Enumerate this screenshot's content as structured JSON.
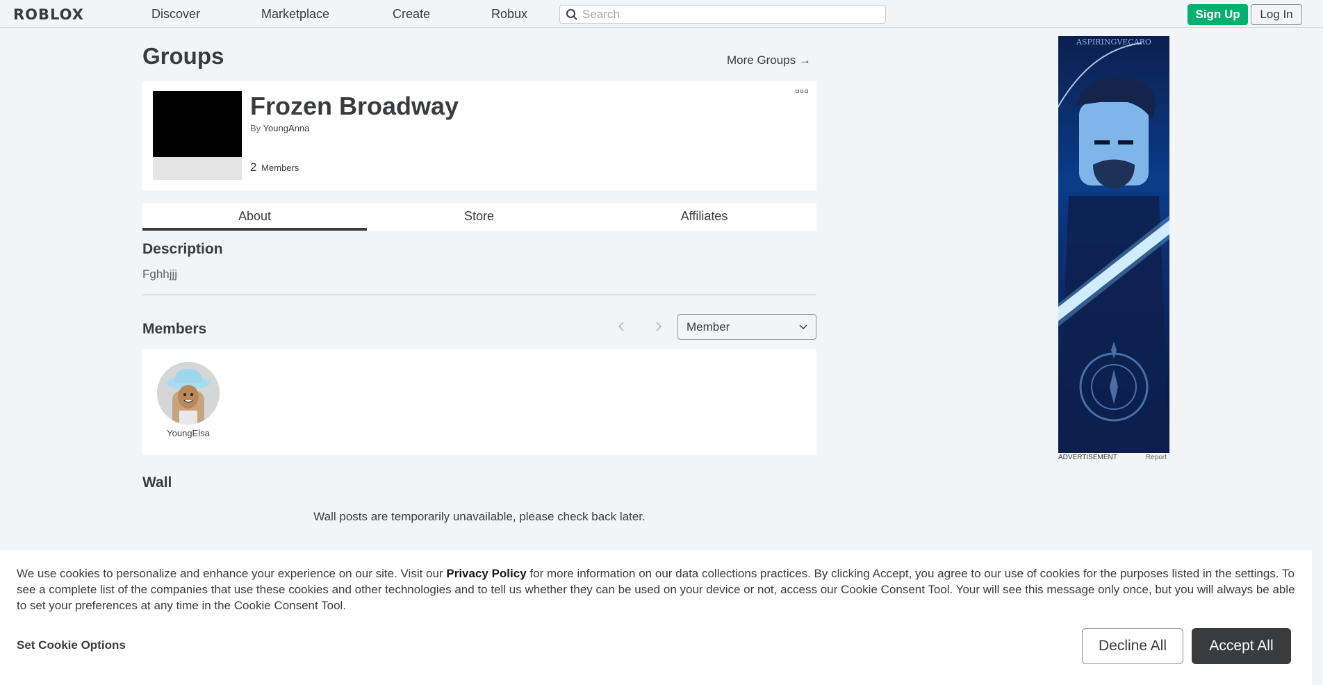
{
  "nav": {
    "logo": "ROBLOX",
    "links": [
      "Discover",
      "Marketplace",
      "Create",
      "Robux"
    ],
    "search_placeholder": "Search",
    "signup": "Sign Up",
    "login": "Log In"
  },
  "page": {
    "heading": "Groups",
    "more_groups": "More Groups →"
  },
  "group": {
    "name": "Frozen Broadway",
    "by_label": "By",
    "owner": "YoungAnna",
    "member_count": "2",
    "members_label": "Members"
  },
  "tabs": [
    "About",
    "Store",
    "Affiliates"
  ],
  "description": {
    "heading": "Description",
    "text": "Fghhjjj"
  },
  "members": {
    "heading": "Members",
    "role_selected": "Member",
    "list": [
      {
        "name": "YoungElsa"
      }
    ]
  },
  "wall": {
    "heading": "Wall",
    "message": "Wall posts are temporarily unavailable, please check back later."
  },
  "ad": {
    "label": "ADVERTISEMENT",
    "report": "Report",
    "brand_text": "ASPIRINGVECARO"
  },
  "cookie": {
    "text_before": "We use cookies to personalize and enhance your experience on our site. Visit our ",
    "privacy_link": "Privacy Policy",
    "text_after": " for more information on our data collections practices. By clicking Accept, you agree to our use of cookies for the purposes listed in the settings. To see a complete list of the companies that use these cookies and other technologies and to tell us whether they can be used on your device or not, access our Cookie Consent Tool. Your will see this message only once, but you will always be able to set your preferences at any time in the Cookie Consent Tool.",
    "set_options": "Set Cookie Options",
    "decline": "Decline All",
    "accept": "Accept All"
  },
  "colors": {
    "signup_green": "#00b06f",
    "accept_dark": "#393b3d",
    "background": "#f2f4f5"
  }
}
